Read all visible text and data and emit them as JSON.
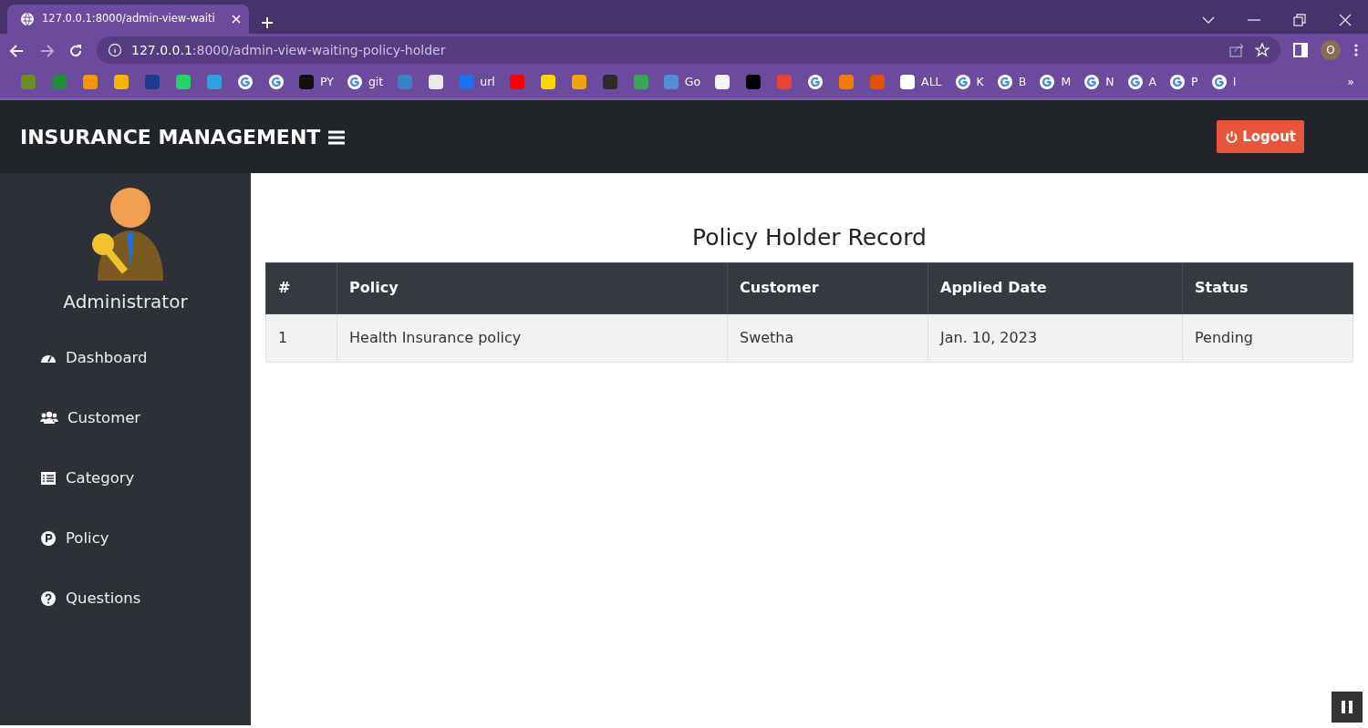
{
  "browser": {
    "tab_title": "127.0.0.1:8000/admin-view-waiti",
    "address_host": "127.0.0.1",
    "address_path": ":8000/admin-view-waiting-policy-holder",
    "profile_initial": "O",
    "bookmarks": [
      {
        "kind": "site",
        "color": "#6b8e23"
      },
      {
        "kind": "site",
        "color": "#1e8e3e"
      },
      {
        "kind": "site",
        "color": "#f29900"
      },
      {
        "kind": "site",
        "color": "#f4b400"
      },
      {
        "kind": "site",
        "color": "#1a3d8f"
      },
      {
        "kind": "site",
        "color": "#25d366"
      },
      {
        "kind": "site",
        "color": "#2aa3de"
      },
      {
        "kind": "google"
      },
      {
        "kind": "google"
      },
      {
        "kind": "site",
        "color": "#111111",
        "label": "PY"
      },
      {
        "kind": "google",
        "label": "git"
      },
      {
        "kind": "site",
        "color": "#3b82c4"
      },
      {
        "kind": "site",
        "color": "#e8eaed"
      },
      {
        "kind": "site",
        "color": "#1a73e8",
        "label": "url"
      },
      {
        "kind": "site",
        "color": "#ff0000"
      },
      {
        "kind": "site",
        "color": "#ffd600"
      },
      {
        "kind": "site",
        "color": "#f4a300"
      },
      {
        "kind": "site",
        "color": "#2b2b2b"
      },
      {
        "kind": "site",
        "color": "#34a853"
      },
      {
        "kind": "site",
        "color": "#4f8fd8",
        "label": "Go"
      },
      {
        "kind": "site",
        "color": "#f5f5f5"
      },
      {
        "kind": "site",
        "color": "#000000"
      },
      {
        "kind": "site",
        "color": "#ea4335"
      },
      {
        "kind": "google"
      },
      {
        "kind": "site",
        "color": "#f57c00"
      },
      {
        "kind": "site",
        "color": "#e65100"
      },
      {
        "kind": "site",
        "color": "#ffffff",
        "label": "ALL"
      },
      {
        "kind": "google",
        "label": "K"
      },
      {
        "kind": "google",
        "label": "B"
      },
      {
        "kind": "google",
        "label": "M"
      },
      {
        "kind": "google",
        "label": "N"
      },
      {
        "kind": "google",
        "label": "A"
      },
      {
        "kind": "google",
        "label": "P"
      },
      {
        "kind": "google",
        "label": "I"
      }
    ],
    "overflow": "»"
  },
  "app": {
    "brand": "INSURANCE MANAGEMENT",
    "logout": "Logout",
    "user_name": "Administrator",
    "menu": [
      {
        "kind": "dashboard",
        "label": "Dashboard"
      },
      {
        "kind": "customer",
        "label": "Customer"
      },
      {
        "kind": "category",
        "label": "Category"
      },
      {
        "kind": "policy",
        "label": "Policy"
      },
      {
        "kind": "questions",
        "label": "Questions"
      }
    ]
  },
  "content": {
    "title": "Policy Holder Record",
    "table": {
      "columns": [
        "#",
        "Policy",
        "Customer",
        "Applied Date",
        "Status"
      ],
      "rows": [
        [
          "1",
          "Health Insurance policy",
          "Swetha",
          "Jan. 10, 2023",
          "Pending"
        ]
      ]
    }
  }
}
